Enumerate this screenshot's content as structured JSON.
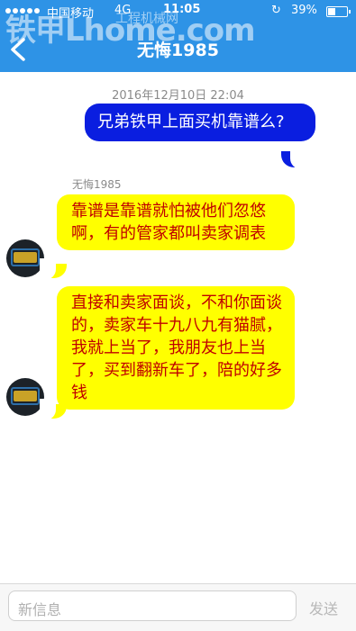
{
  "status_bar": {
    "carrier": "中国移动",
    "network": "4G",
    "time": "11:05",
    "battery_percent": "39%",
    "battery_level": 0.39
  },
  "watermark": {
    "text": "铁甲Lhome.com",
    "sub": "工程机械网"
  },
  "header": {
    "title": "无悔1985",
    "back_icon": "chevron-left-icon",
    "color": "#2e93e6"
  },
  "conversation": {
    "timestamp": "2016年12月10日 22:04",
    "outgoing": [
      {
        "text": "兄弟铁甲上面买机靠谱么?"
      }
    ],
    "sender_name": "无悔1985",
    "incoming": [
      {
        "text": "靠谱是靠谱就怕被他们忽悠啊，有的管家都叫卖家调表"
      },
      {
        "text": "直接和卖家面谈，不和你面谈的，卖家车十九八九有猫腻，我就上当了，我朋友也上当了，买到翻新车了，陪的好多钱"
      }
    ]
  },
  "composer": {
    "placeholder": "新信息",
    "send_label": "发送"
  },
  "colors": {
    "outgoing_bubble": "#0a1ee0",
    "incoming_bubble": "#ffff00",
    "incoming_text": "#c00000"
  }
}
